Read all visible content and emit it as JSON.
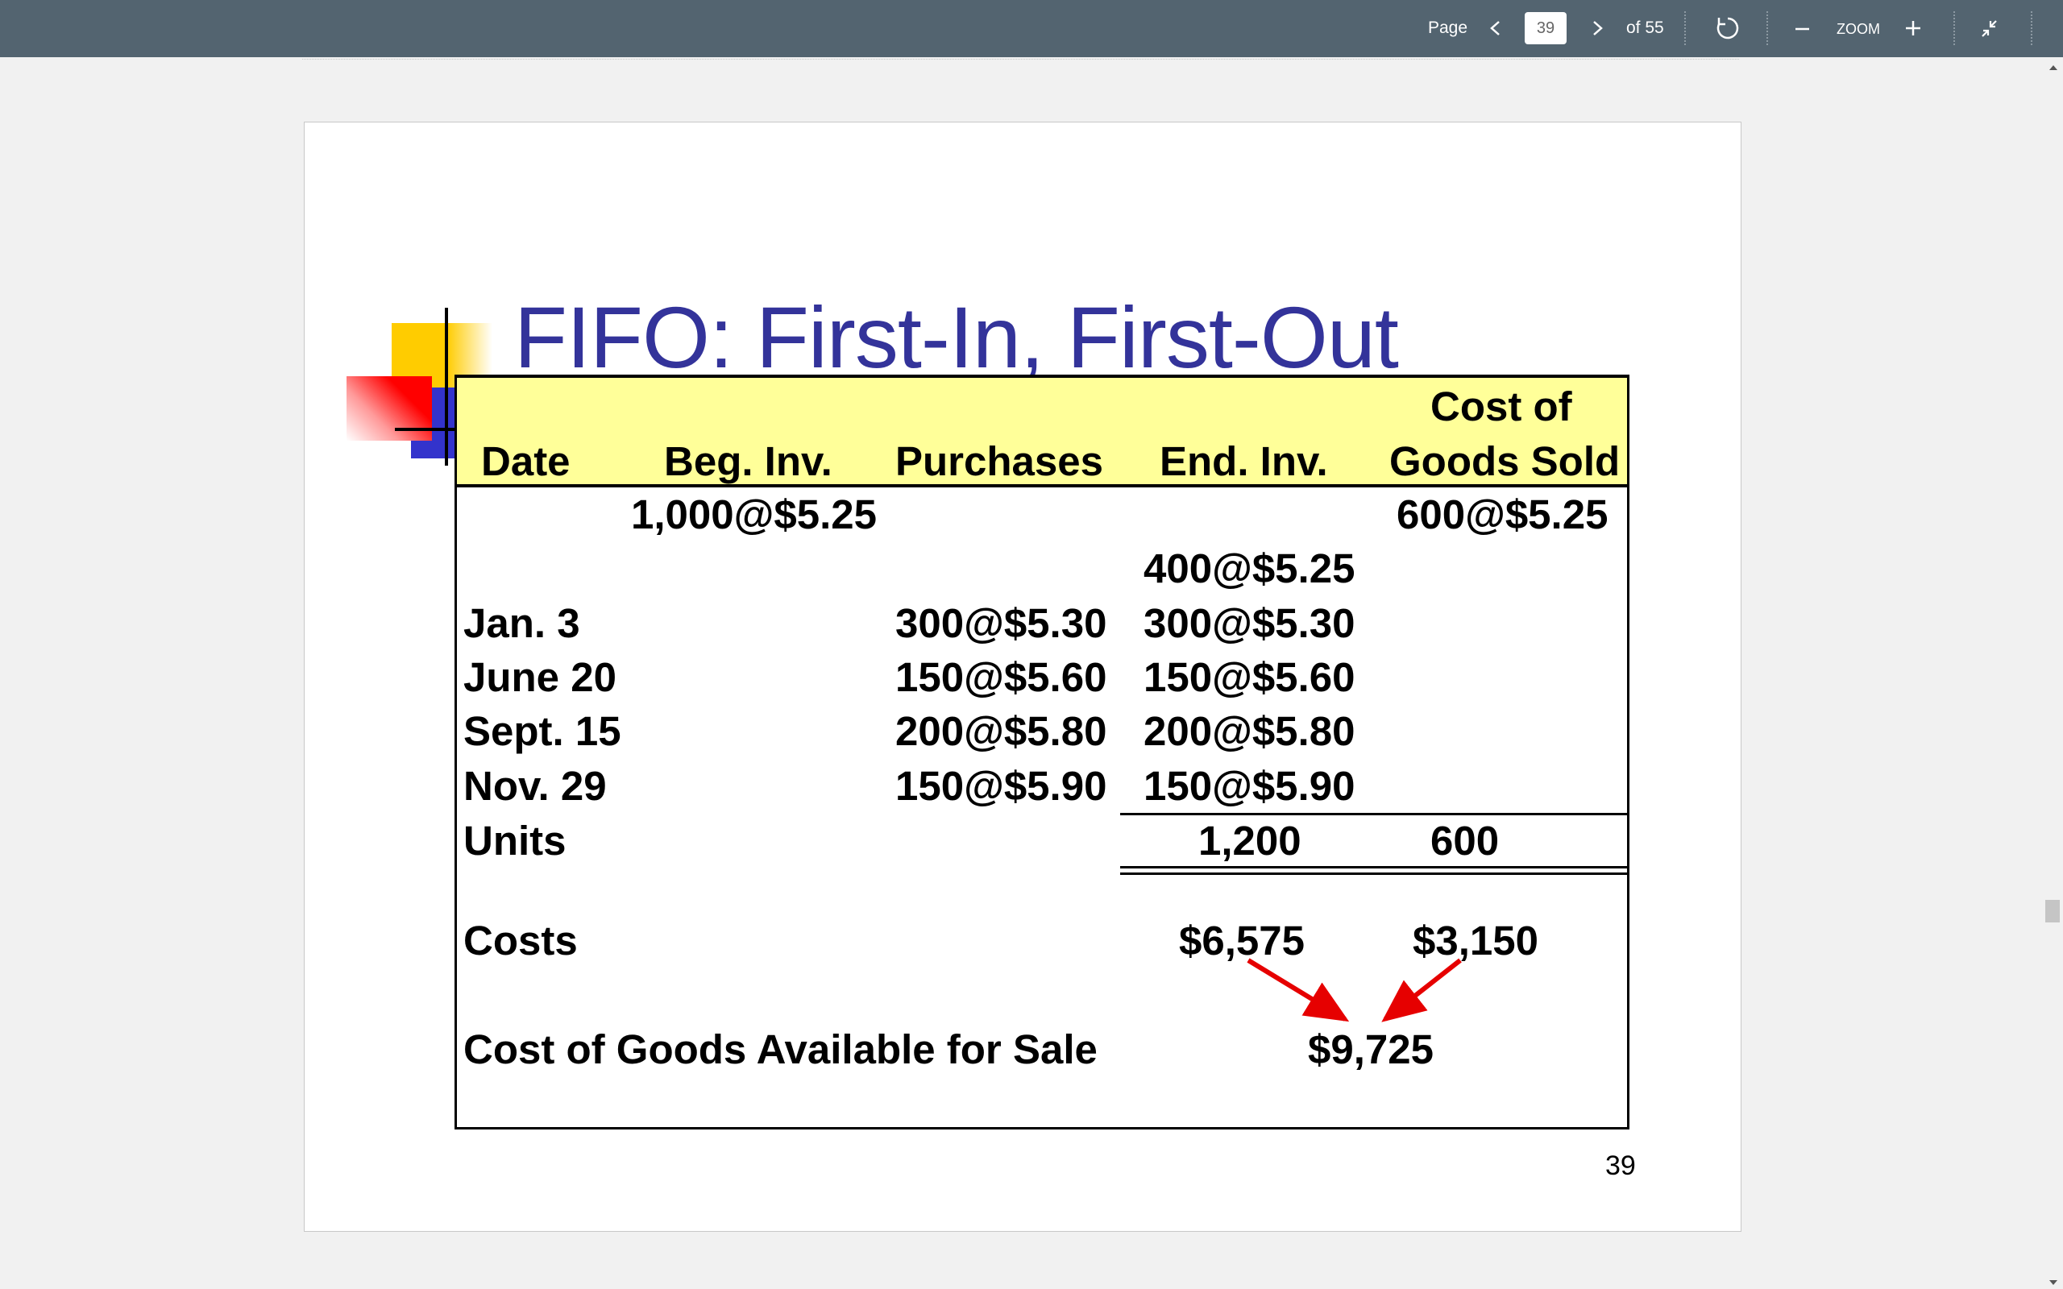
{
  "toolbar": {
    "page_label": "Page",
    "current_page": "39",
    "page_total": "of 55",
    "zoom_label": "ZOOM",
    "icons": [
      "chevron-left-icon",
      "chevron-right-icon",
      "rotate-icon",
      "minus-icon",
      "plus-icon",
      "collapse-icon"
    ]
  },
  "slide": {
    "title": "FIFO: First-In, First-Out",
    "page_number": "39",
    "table": {
      "headers": {
        "date": "Date",
        "beg_inv": "Beg. Inv.",
        "purchases": "Purchases",
        "end_inv": "End. Inv.",
        "cogs_line1": "Cost of",
        "cogs_line2": "Goods Sold"
      },
      "rows": [
        {
          "date": "",
          "beg_inv": "1,000@$5.25",
          "purchases": "",
          "end_inv": "",
          "cogs": "600@$5.25"
        },
        {
          "date": "",
          "beg_inv": "",
          "purchases": "",
          "end_inv": "400@$5.25",
          "cogs": ""
        },
        {
          "date": "Jan. 3",
          "beg_inv": "",
          "purchases": "300@$5.30",
          "end_inv": "300@$5.30",
          "cogs": ""
        },
        {
          "date": "June 20",
          "beg_inv": "",
          "purchases": "150@$5.60",
          "end_inv": "150@$5.60",
          "cogs": ""
        },
        {
          "date": "Sept. 15",
          "beg_inv": "",
          "purchases": "200@$5.80",
          "end_inv": "200@$5.80",
          "cogs": ""
        },
        {
          "date": "Nov. 29",
          "beg_inv": "",
          "purchases": "150@$5.90",
          "end_inv": "150@$5.90",
          "cogs": ""
        }
      ],
      "units": {
        "label": "Units",
        "end_inv": "1,200",
        "cogs": "600"
      },
      "costs": {
        "label": "Costs",
        "end_inv": "$6,575",
        "cogs": "$3,150"
      },
      "available": {
        "label": "Cost of Goods Available for Sale",
        "value": "$9,725"
      }
    }
  },
  "colors": {
    "toolbar_bg": "#536470",
    "title": "#33339a",
    "table_header_bg": "#ffff99",
    "arrow": "#e60000",
    "deco_yellow": "#ffcc00",
    "deco_red": "#ff0000",
    "deco_blue": "#3333cc"
  }
}
